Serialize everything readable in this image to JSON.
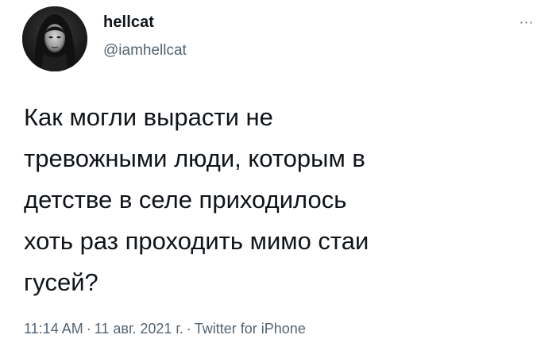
{
  "author": {
    "display_name": "hellcat",
    "handle": "@iamhellcat"
  },
  "menu": {
    "more_label": "···"
  },
  "tweet": {
    "text": "Как могли вырасти не\nтревожными люди, которым в\nдетстве в селе приходилось\nхоть раз проходить мимо стаи\nгусей?"
  },
  "meta": {
    "time": "11:14 AM",
    "separator": "·",
    "date": "11 авг. 2021 г.",
    "source": "Twitter for iPhone"
  },
  "colors": {
    "text": "#0f1419",
    "secondary": "#536471",
    "background": "#ffffff"
  },
  "icons": {
    "avatar": "user-avatar",
    "more": "more-horizontal-icon"
  }
}
